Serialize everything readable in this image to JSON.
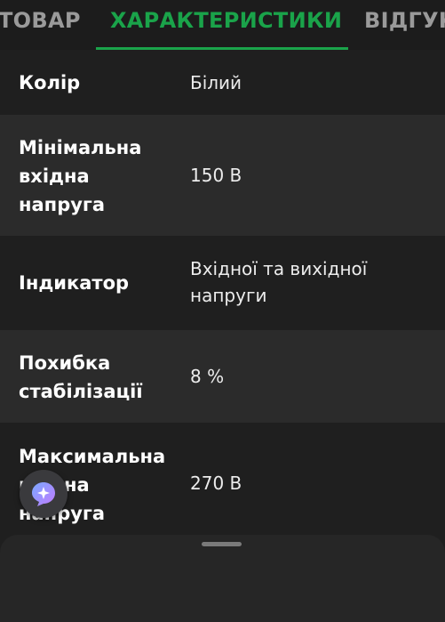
{
  "tabs": [
    {
      "label": "ТОВАР",
      "active": false
    },
    {
      "label": "ХАРАКТЕРИСТИКИ",
      "active": true
    },
    {
      "label": "ВІДГУКИ",
      "active": false
    }
  ],
  "specs": [
    {
      "key": "Колір",
      "value": "Білий"
    },
    {
      "key": "Мінімальна вхідна напруга",
      "value": "150 В"
    },
    {
      "key": "Індикатор",
      "value": "Вхідної та вихідної напруги"
    },
    {
      "key": "Похибка стабілізації",
      "value": "8 %"
    },
    {
      "key": "Максимальна вхідна напруга",
      "value": "270 В"
    }
  ],
  "colors": {
    "accent": "#1aa34a",
    "background": "#1f1f1f",
    "row_alt": "#2b2b2b",
    "tab_inactive": "#9a9a9a"
  },
  "icons": {
    "fab": "sparkle-chat-icon"
  }
}
